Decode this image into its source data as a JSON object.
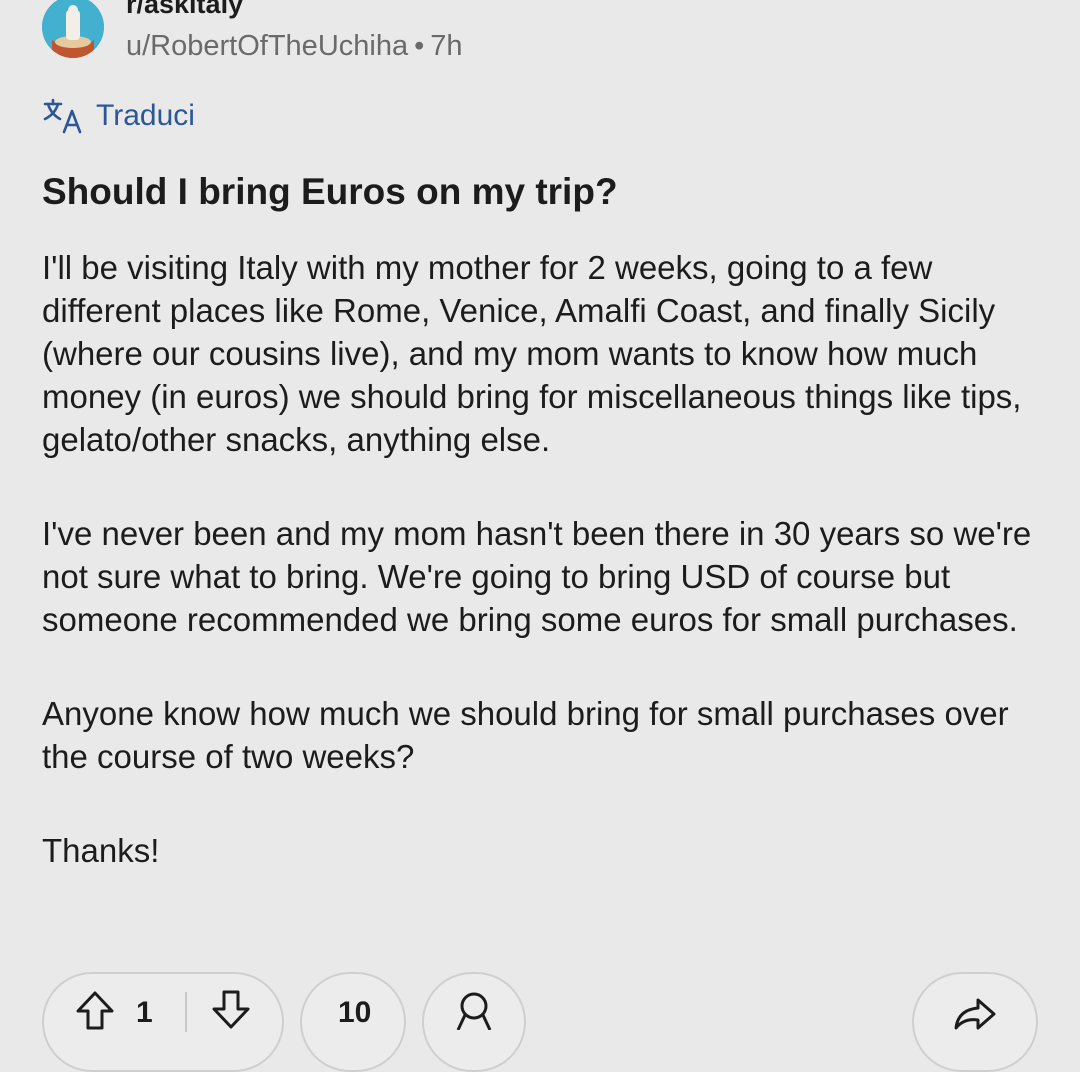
{
  "post": {
    "subreddit": "r/askitaly",
    "author": "u/RobertOfTheUchiha",
    "separator": "•",
    "time_ago": "7h",
    "translate_label": "Traduci",
    "title": "Should I bring Euros on my trip?",
    "body": [
      "I'll be visiting Italy with my mother for 2 weeks, going to a few different places like Rome, Venice, Amalfi Coast, and finally Sicily (where our cousins live), and my mom wants to know how much money (in euros) we should bring for miscellaneous things like tips, gelato/other snacks, anything else.",
      "I've never been and my mom hasn't been there in 30 years so we're not sure what to bring. We're going to bring USD of course but someone recommended we bring some euros for small purchases.",
      "Anyone know how much we should bring for small purchases over the course of two weeks?",
      "Thanks!"
    ]
  },
  "actions": {
    "vote_count": "1",
    "comment_count": "10"
  },
  "colors": {
    "background": "#e9e9e9",
    "link_blue": "#2b5797",
    "meta_gray": "#6a6a6a"
  },
  "icons": {
    "translate": "translate-icon",
    "upvote": "upvote-arrow-icon",
    "downvote": "downvote-arrow-icon",
    "award": "award-icon",
    "share": "share-icon"
  }
}
